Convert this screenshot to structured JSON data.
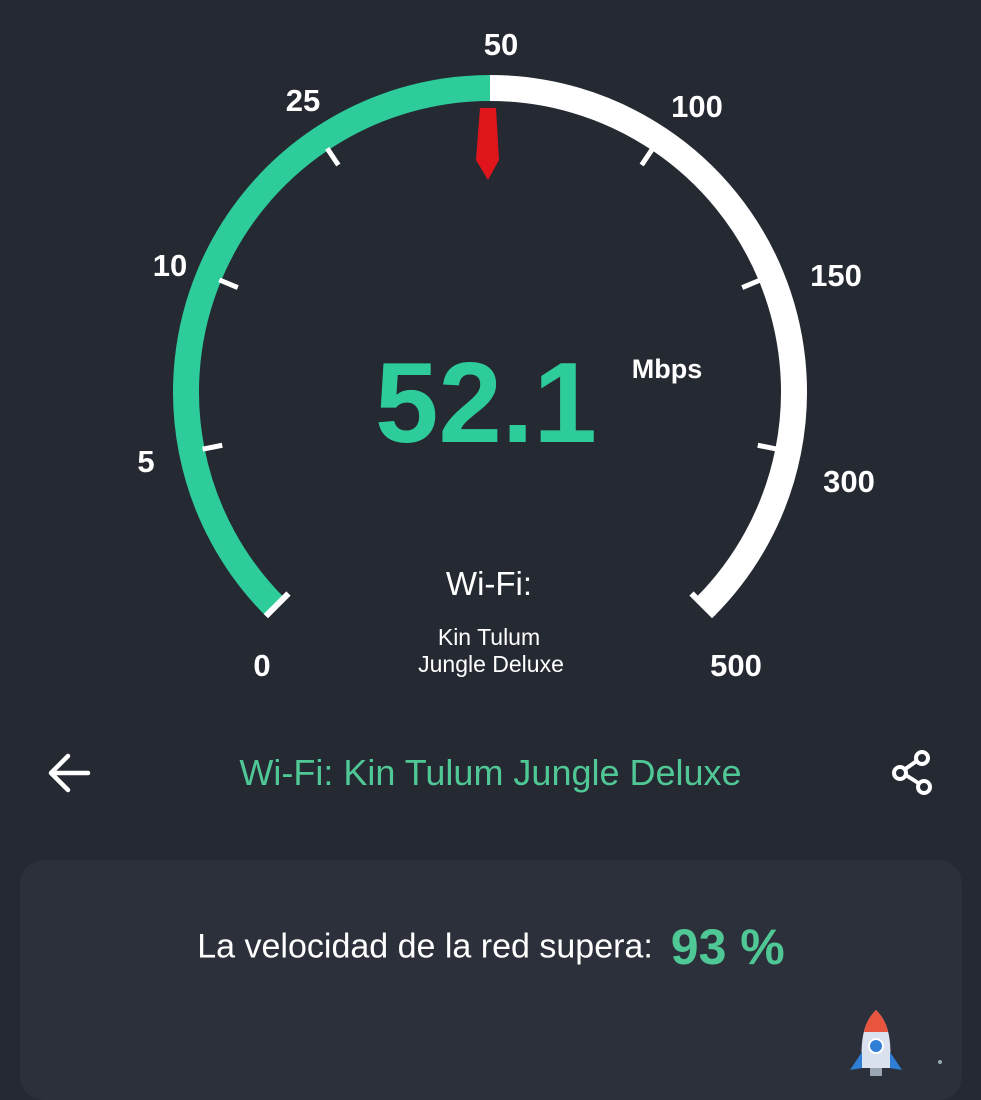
{
  "gauge": {
    "scale_labels": [
      "0",
      "5",
      "10",
      "25",
      "50",
      "100",
      "150",
      "300",
      "500"
    ],
    "speed_value": "52.1",
    "speed_unit": "Mbps",
    "network_type_label": "Wi-Fi:",
    "network_name_line1": "Kin Tulum",
    "network_name_line2": "Jungle Deluxe",
    "progress_fraction": 0.5,
    "progress_color": "#2ecc9a",
    "track_color": "#ffffff",
    "needle_color": "#e0151b"
  },
  "header": {
    "back_icon": "arrow-left-icon",
    "title": "Wi-Fi: Kin Tulum Jungle Deluxe",
    "share_icon": "share-icon"
  },
  "result_card": {
    "exceeds_label": "La velocidad de la red supera:",
    "exceeds_value": "93 %",
    "rocket_icon": "rocket-icon"
  },
  "colors": {
    "background": "#252932",
    "card": "#2c303a",
    "accent": "#4fc896"
  }
}
